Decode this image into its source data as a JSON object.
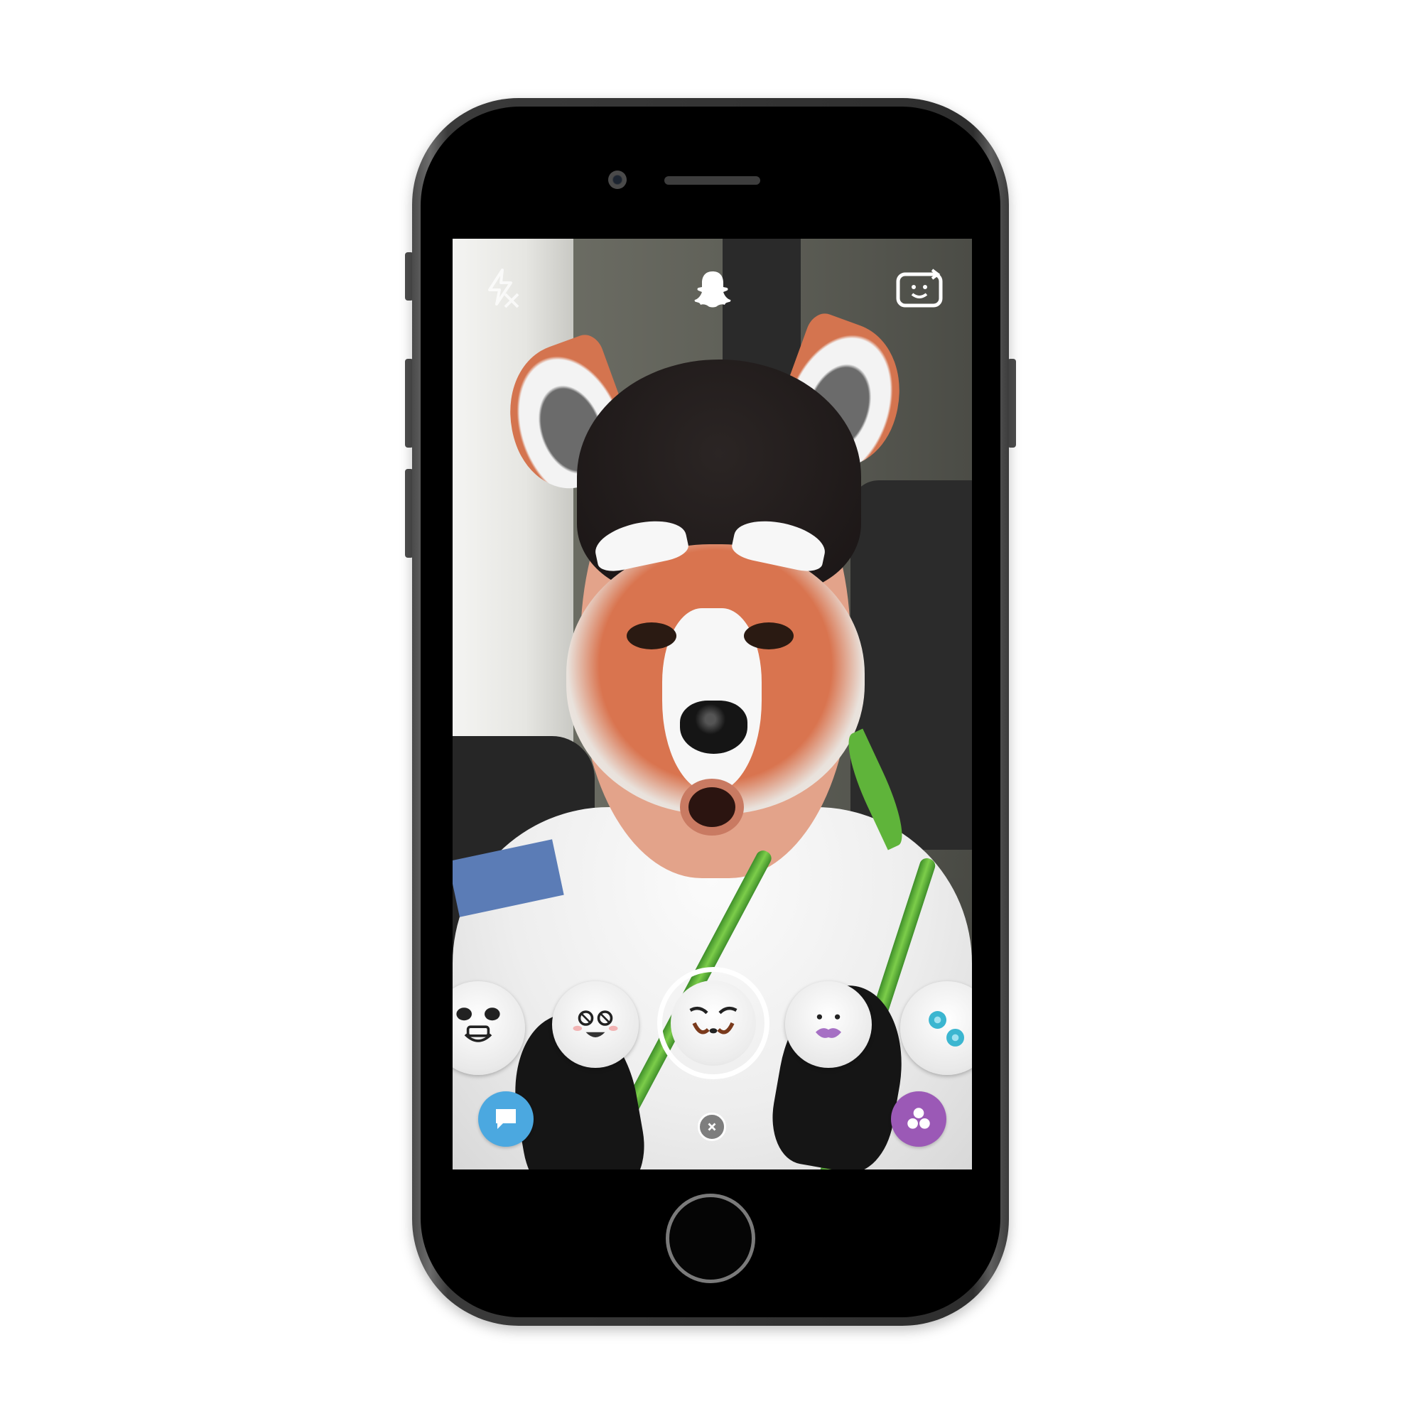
{
  "app": {
    "name": "Snapchat camera",
    "mode": "lens"
  },
  "top_bar": {
    "flash_icon": "flash-off-icon",
    "ghost_icon": "snapchat-ghost-icon",
    "flip_icon": "camera-flip-icon"
  },
  "lens_carousel": {
    "items": [
      {
        "icon": "panda-face-lens-icon",
        "selected": false
      },
      {
        "icon": "dizzy-face-lens-icon",
        "selected": false
      },
      {
        "icon": "red-panda-lens-icon",
        "selected": true
      },
      {
        "icon": "lips-face-lens-icon",
        "selected": false
      },
      {
        "icon": "blue-flowers-lens-icon",
        "selected": false
      }
    ]
  },
  "bottom_bar": {
    "chat_icon": "chat-icon",
    "close_icon": "close-icon",
    "stories_icon": "stories-icon"
  },
  "colors": {
    "chat_blue": "#4ba8e0",
    "stories_purple": "#9b59b6",
    "phone_frame": "#3a3a3a"
  }
}
